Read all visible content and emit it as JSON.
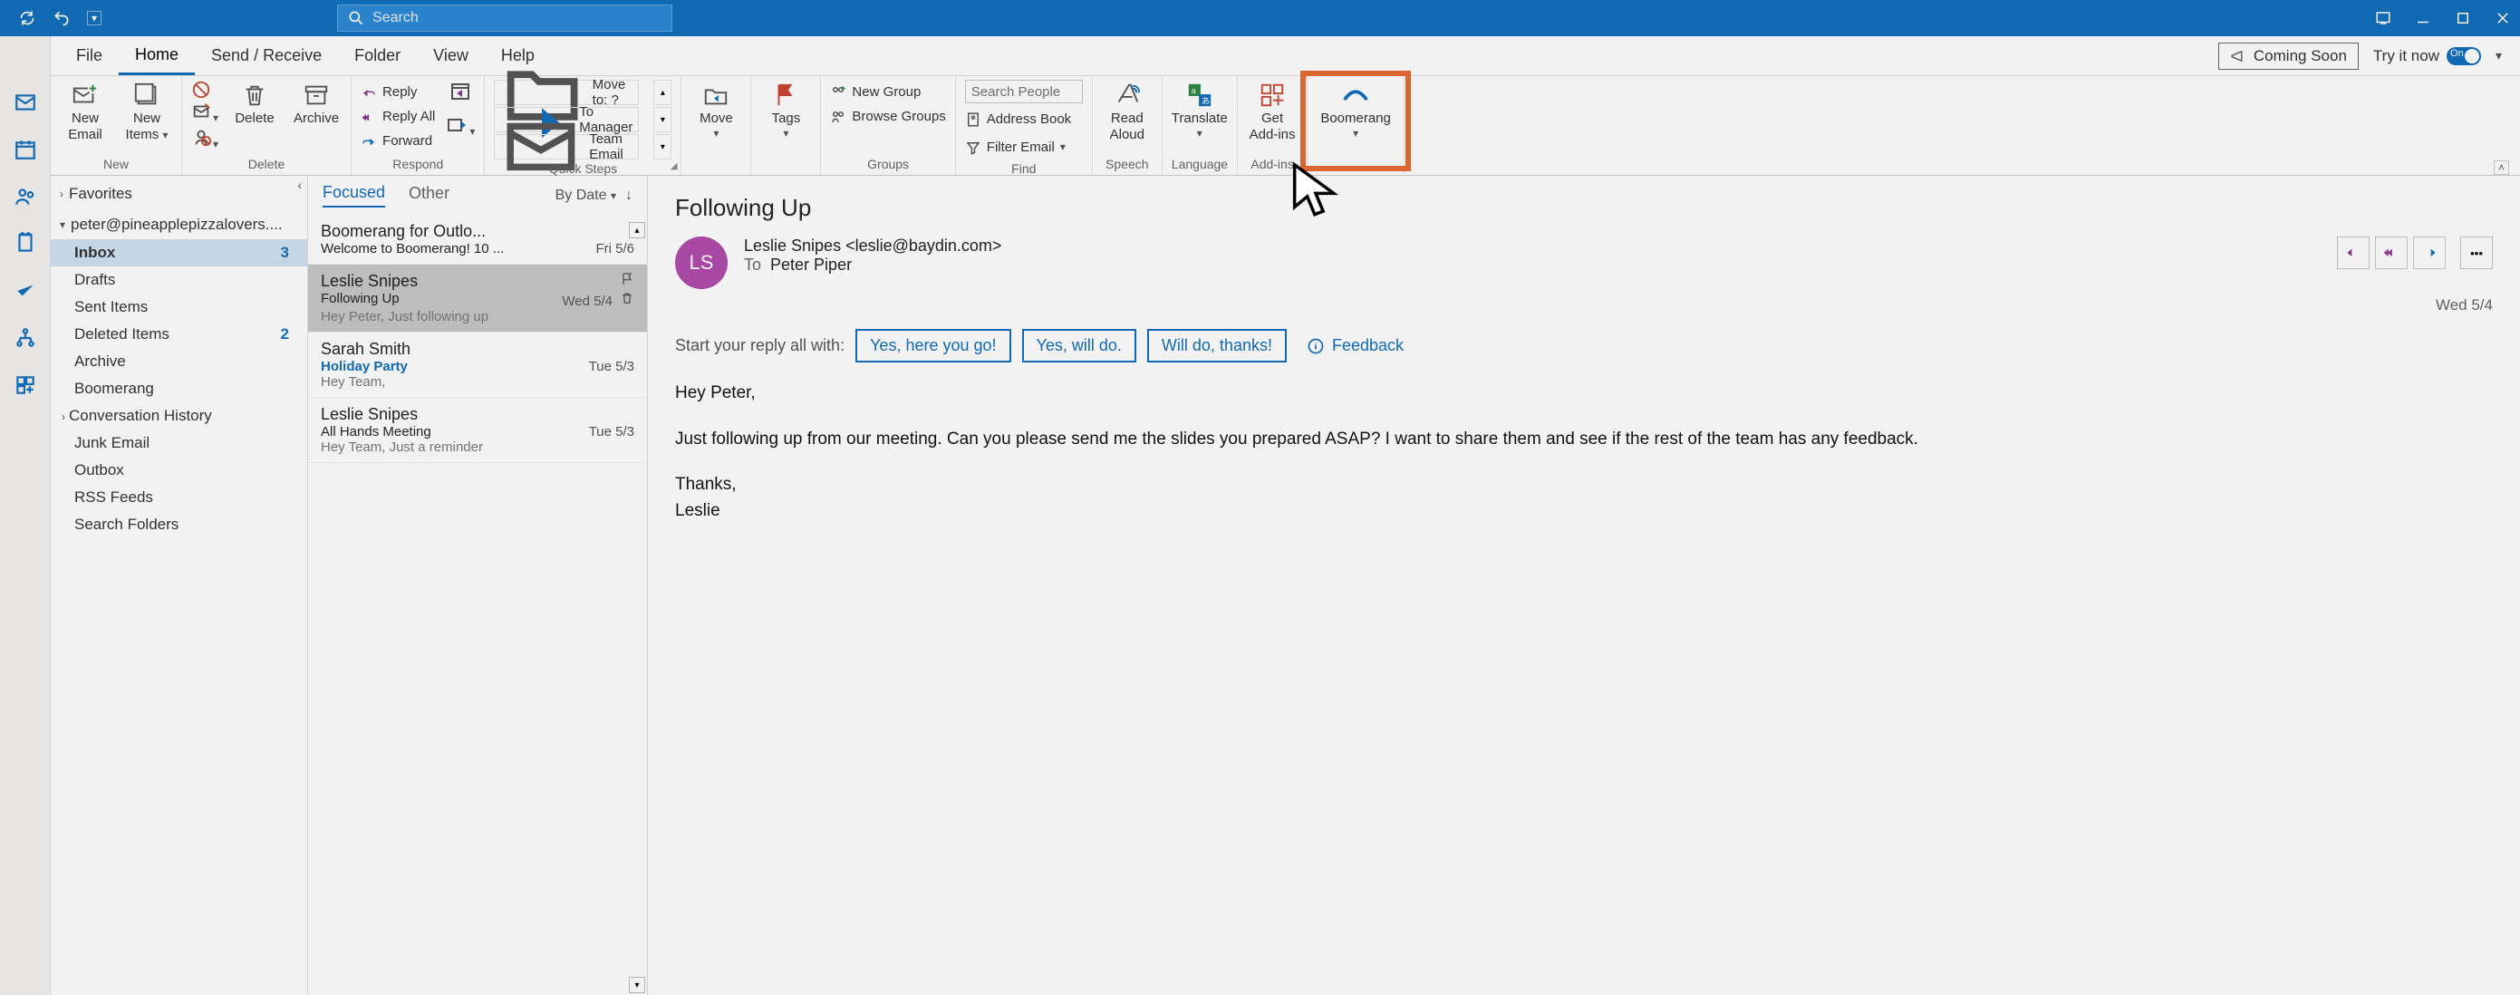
{
  "titlebar": {
    "search_placeholder": "Search"
  },
  "tabs": {
    "file": "File",
    "home": "Home",
    "send_receive": "Send / Receive",
    "folder": "Folder",
    "view": "View",
    "help": "Help",
    "coming_soon": "Coming Soon",
    "try_it": "Try it now",
    "toggle": "On"
  },
  "ribbon": {
    "new": {
      "new_email_l1": "New",
      "new_email_l2": "Email",
      "new_items_l1": "New",
      "new_items_l2": "Items",
      "group": "New"
    },
    "delete": {
      "delete": "Delete",
      "archive": "Archive",
      "group": "Delete"
    },
    "respond": {
      "reply": "Reply",
      "reply_all": "Reply All",
      "forward": "Forward",
      "group": "Respond"
    },
    "quicksteps": {
      "moveto": "Move to: ?",
      "to_manager": "To Manager",
      "team_email": "Team Email",
      "group": "Quick Steps"
    },
    "move": {
      "move": "Move",
      "tags": "Tags"
    },
    "groups": {
      "new_group": "New Group",
      "browse_groups": "Browse Groups",
      "group": "Groups"
    },
    "find": {
      "search_people_ph": "Search People",
      "address_book": "Address Book",
      "filter_email": "Filter Email",
      "group": "Find"
    },
    "speech": {
      "read_aloud_l1": "Read",
      "read_aloud_l2": "Aloud",
      "group": "Speech"
    },
    "language": {
      "translate": "Translate",
      "group": "Language"
    },
    "addins": {
      "get_l1": "Get",
      "get_l2": "Add-ins",
      "group": "Add-ins"
    },
    "boomerang": {
      "label": "Boomerang"
    }
  },
  "folderpane": {
    "favorites": "Favorites",
    "account": "peter@pineapplepizzalovers....",
    "items": [
      {
        "name": "Inbox",
        "badge": "3",
        "selected": true
      },
      {
        "name": "Drafts"
      },
      {
        "name": "Sent Items"
      },
      {
        "name": "Deleted Items",
        "badge": "2"
      },
      {
        "name": "Archive"
      },
      {
        "name": "Boomerang"
      },
      {
        "name": "Conversation History",
        "chev": true
      },
      {
        "name": "Junk Email"
      },
      {
        "name": "Outbox"
      },
      {
        "name": "RSS Feeds"
      },
      {
        "name": "Search Folders"
      }
    ]
  },
  "msglist": {
    "tab_focused": "Focused",
    "tab_other": "Other",
    "sort_label": "By Date",
    "messages": [
      {
        "from": "Boomerang for Outlo...",
        "subject": "Welcome to Boomerang! 10 ...",
        "date": "Fri 5/6"
      },
      {
        "from": "Leslie Snipes",
        "subject": "Following Up",
        "date": "Wed 5/4",
        "preview": "Hey Peter,  Just following up",
        "selected": true,
        "flag": true,
        "del": true
      },
      {
        "from": "Sarah Smith",
        "subject": "Holiday Party",
        "date": "Tue 5/3",
        "preview": "Hey Team,",
        "unread": true
      },
      {
        "from": "Leslie Snipes",
        "subject": "All Hands Meeting",
        "date": "Tue 5/3",
        "preview": "Hey Team,  Just a reminder"
      }
    ]
  },
  "reading": {
    "subject": "Following Up",
    "avatar": "LS",
    "from": "Leslie Snipes <leslie@baydin.com>",
    "to_label": "To",
    "to_value": "Peter Piper",
    "date": "Wed 5/4",
    "reply_prompt": "Start your reply all with:",
    "suggestions": [
      "Yes, here you go!",
      "Yes, will do.",
      "Will do, thanks!"
    ],
    "feedback": "Feedback",
    "body_greeting": "Hey Peter,",
    "body_p1": "Just following up from our meeting. Can you please send me the slides you prepared ASAP? I want to share them and see if the rest of the team has any feedback.",
    "body_sign1": "Thanks,",
    "body_sign2": "Leslie"
  }
}
